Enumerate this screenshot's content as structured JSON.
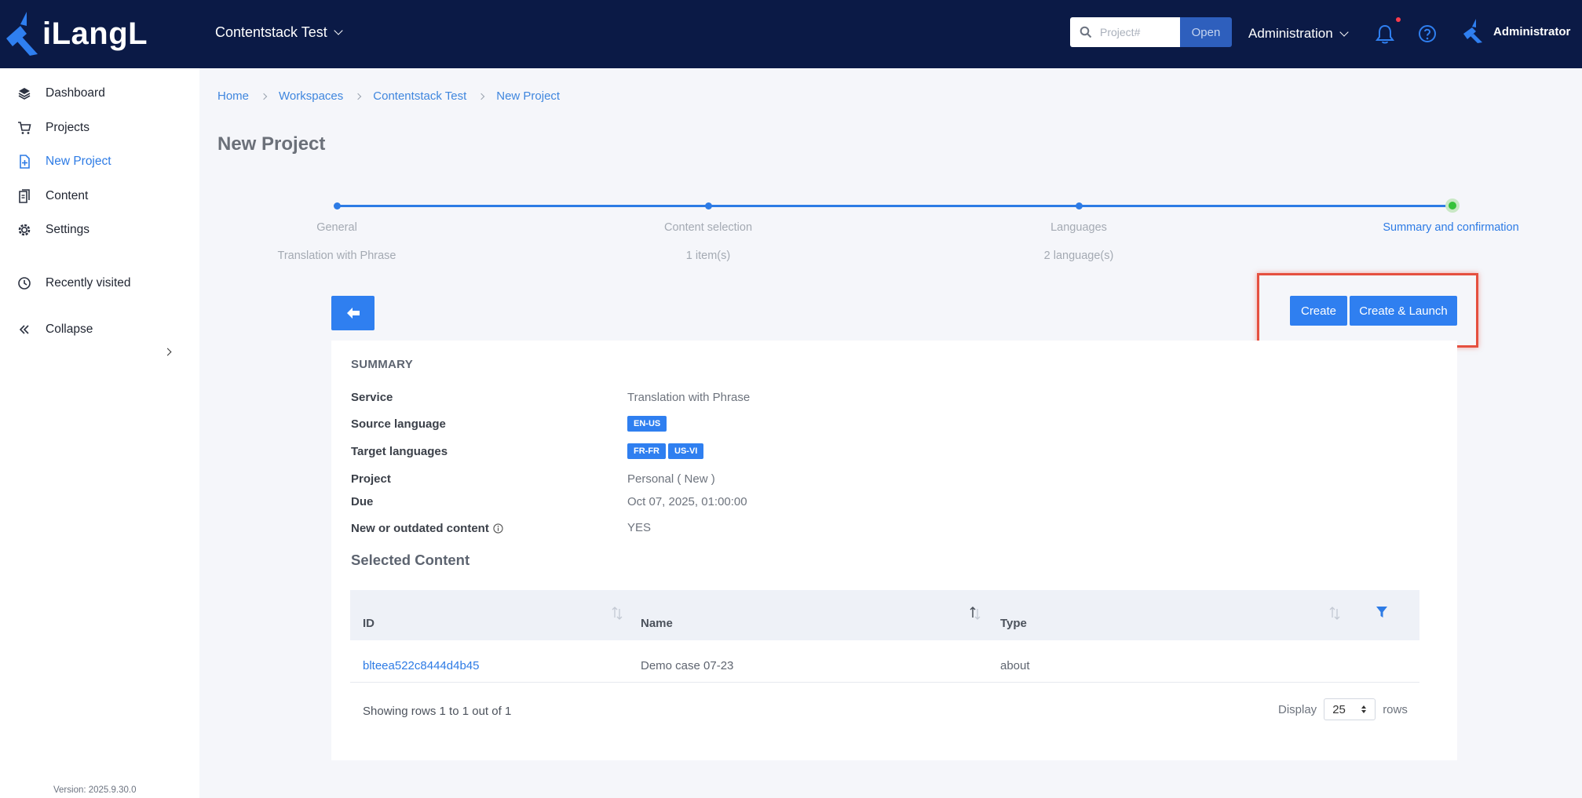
{
  "header": {
    "logo_text": "iLangL",
    "workspace": "Contentstack Test",
    "search_placeholder": "Project#",
    "open_label": "Open",
    "admin_menu": "Administration",
    "user_name": "Administrator",
    "colors": {
      "background": "#0b1a46",
      "notification_dot": "#ff3b4b"
    }
  },
  "sidebar": {
    "items": [
      {
        "label": "Dashboard",
        "icon": "layers-icon"
      },
      {
        "label": "Projects",
        "icon": "cart-icon"
      },
      {
        "label": "New Project",
        "icon": "new-file-icon",
        "active": true
      },
      {
        "label": "Content",
        "icon": "documents-icon"
      },
      {
        "label": "Settings",
        "icon": "gear-icon"
      },
      {
        "label": "Recently visited",
        "icon": "history-icon"
      },
      {
        "label": "Collapse",
        "icon": "double-chevron-left-icon"
      }
    ],
    "version": "Version: 2025.9.30.0"
  },
  "breadcrumb": [
    "Home",
    "Workspaces",
    "Contentstack Test",
    "New Project"
  ],
  "page_title": "New Project",
  "stepper": {
    "steps": [
      {
        "label": "General",
        "sub": "Translation with Phrase"
      },
      {
        "label": "Content selection",
        "sub": "1 item(s)"
      },
      {
        "label": "Languages",
        "sub": "2 language(s)"
      },
      {
        "label": "Summary and confirmation",
        "sub": "",
        "current": true
      }
    ]
  },
  "actions": {
    "create": "Create",
    "create_launch": "Create & Launch"
  },
  "summary": {
    "heading": "SUMMARY",
    "service_label": "Service",
    "service": "Translation with Phrase",
    "source_label": "Source language",
    "source": "EN-US",
    "target_label": "Target languages",
    "targets": [
      "FR-FR",
      "US-VI"
    ],
    "project_label": "Project",
    "project": "Personal ( New )",
    "due_label": "Due",
    "due": "Oct 07, 2025, 01:00:00",
    "outdated_label": "New or outdated content",
    "outdated": "YES"
  },
  "selected_content": {
    "heading": "Selected Content",
    "columns": [
      "ID",
      "Name",
      "Type"
    ],
    "rows": [
      {
        "id": "blteea522c8444d4b45",
        "name": "Demo case 07-23",
        "type": "about"
      }
    ],
    "showing": "Showing rows 1 to 1 out of 1",
    "display_label": "Display",
    "page_size": "25",
    "rows_label": "rows"
  }
}
